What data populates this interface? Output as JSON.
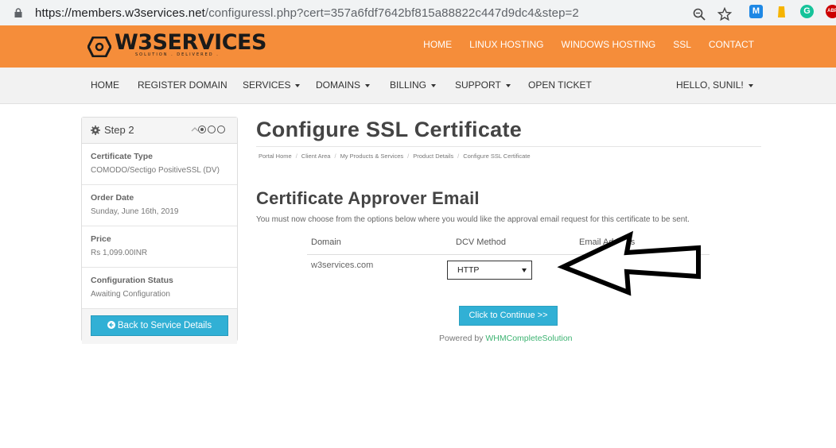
{
  "browser": {
    "url_host": "https://members.w3services.net",
    "url_path": "/configuressl.php?cert=357a6fdf7642bf815a88822c447d9dc4&step=2",
    "ext_m_label": "M",
    "ext_g_label": "G",
    "ext_abp_label": "ABP"
  },
  "header": {
    "logo_text": "W3SERVICES",
    "logo_tagline": "SOLUTION . DELIVERED .",
    "nav": [
      "HOME",
      "LINUX HOSTING",
      "WINDOWS HOSTING",
      "SSL",
      "CONTACT"
    ]
  },
  "main_nav": {
    "home": "HOME",
    "register_domain": "REGISTER DOMAIN",
    "services": "SERVICES",
    "domains": "DOMAINS",
    "billing": "BILLING",
    "support": "SUPPORT",
    "open_ticket": "OPEN TICKET",
    "user": "HELLO, SUNIL!"
  },
  "sidebar": {
    "title": "Step 2",
    "rows": [
      {
        "label": "Certificate Type",
        "value": "COMODO/Sectigo PositiveSSL (DV)"
      },
      {
        "label": "Order Date",
        "value": "Sunday, June 16th, 2019"
      },
      {
        "label": "Price",
        "value": "Rs 1,099.00INR"
      },
      {
        "label": "Configuration Status",
        "value": "Awaiting Configuration"
      }
    ],
    "back_button": "Back to Service Details"
  },
  "content": {
    "page_title": "Configure SSL Certificate",
    "breadcrumb": [
      "Portal Home",
      "Client Area",
      "My Products & Services",
      "Product Details",
      "Configure SSL Certificate"
    ],
    "section_title": "Certificate Approver Email",
    "intro": "You must now choose from the options below where you would like the approval email request for this certificate to be sent.",
    "table": {
      "col_domain": "Domain",
      "col_dcv": "DCV Method",
      "col_email": "Email Address",
      "domain": "w3services.com",
      "dcv_value": "HTTP"
    },
    "continue_button": "Click to Continue >>",
    "powered_prefix": "Powered by",
    "powered_link": "WHMCompleteSolution"
  }
}
